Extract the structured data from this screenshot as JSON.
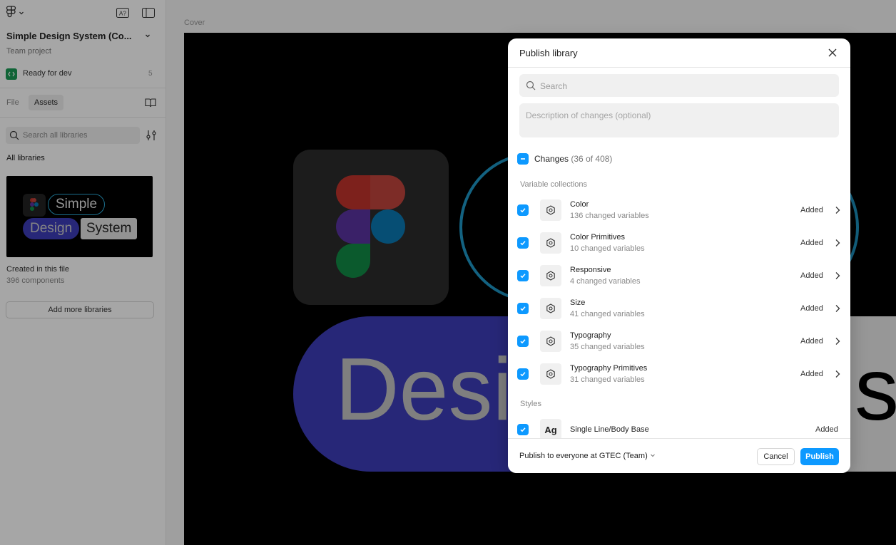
{
  "sidebar": {
    "file_title": "Simple Design System (Co...",
    "team_label": "Team project",
    "dev_status": "Ready for dev",
    "dev_count": "5",
    "tabs": {
      "file": "File",
      "assets": "Assets"
    },
    "search_placeholder": "Search all libraries",
    "all_libraries": "All libraries",
    "library_card": {
      "simple": "Simple",
      "design": "Design",
      "system": "System"
    },
    "created_in": "Created in this file",
    "component_count": "396 components",
    "add_more": "Add more libraries"
  },
  "canvas": {
    "frame_label": "Cover",
    "design_text": "Desi",
    "system_text": "st"
  },
  "modal": {
    "title": "Publish library",
    "search_placeholder": "Search",
    "description_placeholder": "Description of changes (optional)",
    "changes_label": "Changes",
    "changes_count": "(36 of 408)",
    "section_variables": "Variable collections",
    "section_styles": "Styles",
    "variable_rows": [
      {
        "name": "Color",
        "detail": "136 changed variables",
        "status": "Added"
      },
      {
        "name": "Color Primitives",
        "detail": "10 changed variables",
        "status": "Added"
      },
      {
        "name": "Responsive",
        "detail": "4 changed variables",
        "status": "Added"
      },
      {
        "name": "Size",
        "detail": "41 changed variables",
        "status": "Added"
      },
      {
        "name": "Typography",
        "detail": "35 changed variables",
        "status": "Added"
      },
      {
        "name": "Typography Primitives",
        "detail": "31 changed variables",
        "status": "Added"
      }
    ],
    "style_rows": [
      {
        "icon_text": "Ag",
        "name": "Single Line/Body Base",
        "status": "Added"
      }
    ],
    "publish_to": "Publish to everyone at GTEC (Team)",
    "cancel": "Cancel",
    "publish": "Publish"
  },
  "colors": {
    "accent": "#0d99ff",
    "dev_badge": "#1a9a55",
    "brand_purple": "#3d3cb8",
    "brand_cyan": "#1e97c6"
  },
  "icons": [
    "figma-menu-icon",
    "chevron-down-icon",
    "ai-icon",
    "panel-toggle-icon",
    "book-icon",
    "search-icon",
    "filter-icon",
    "close-icon",
    "variable-collection-icon",
    "check-icon",
    "chevron-right-icon"
  ]
}
